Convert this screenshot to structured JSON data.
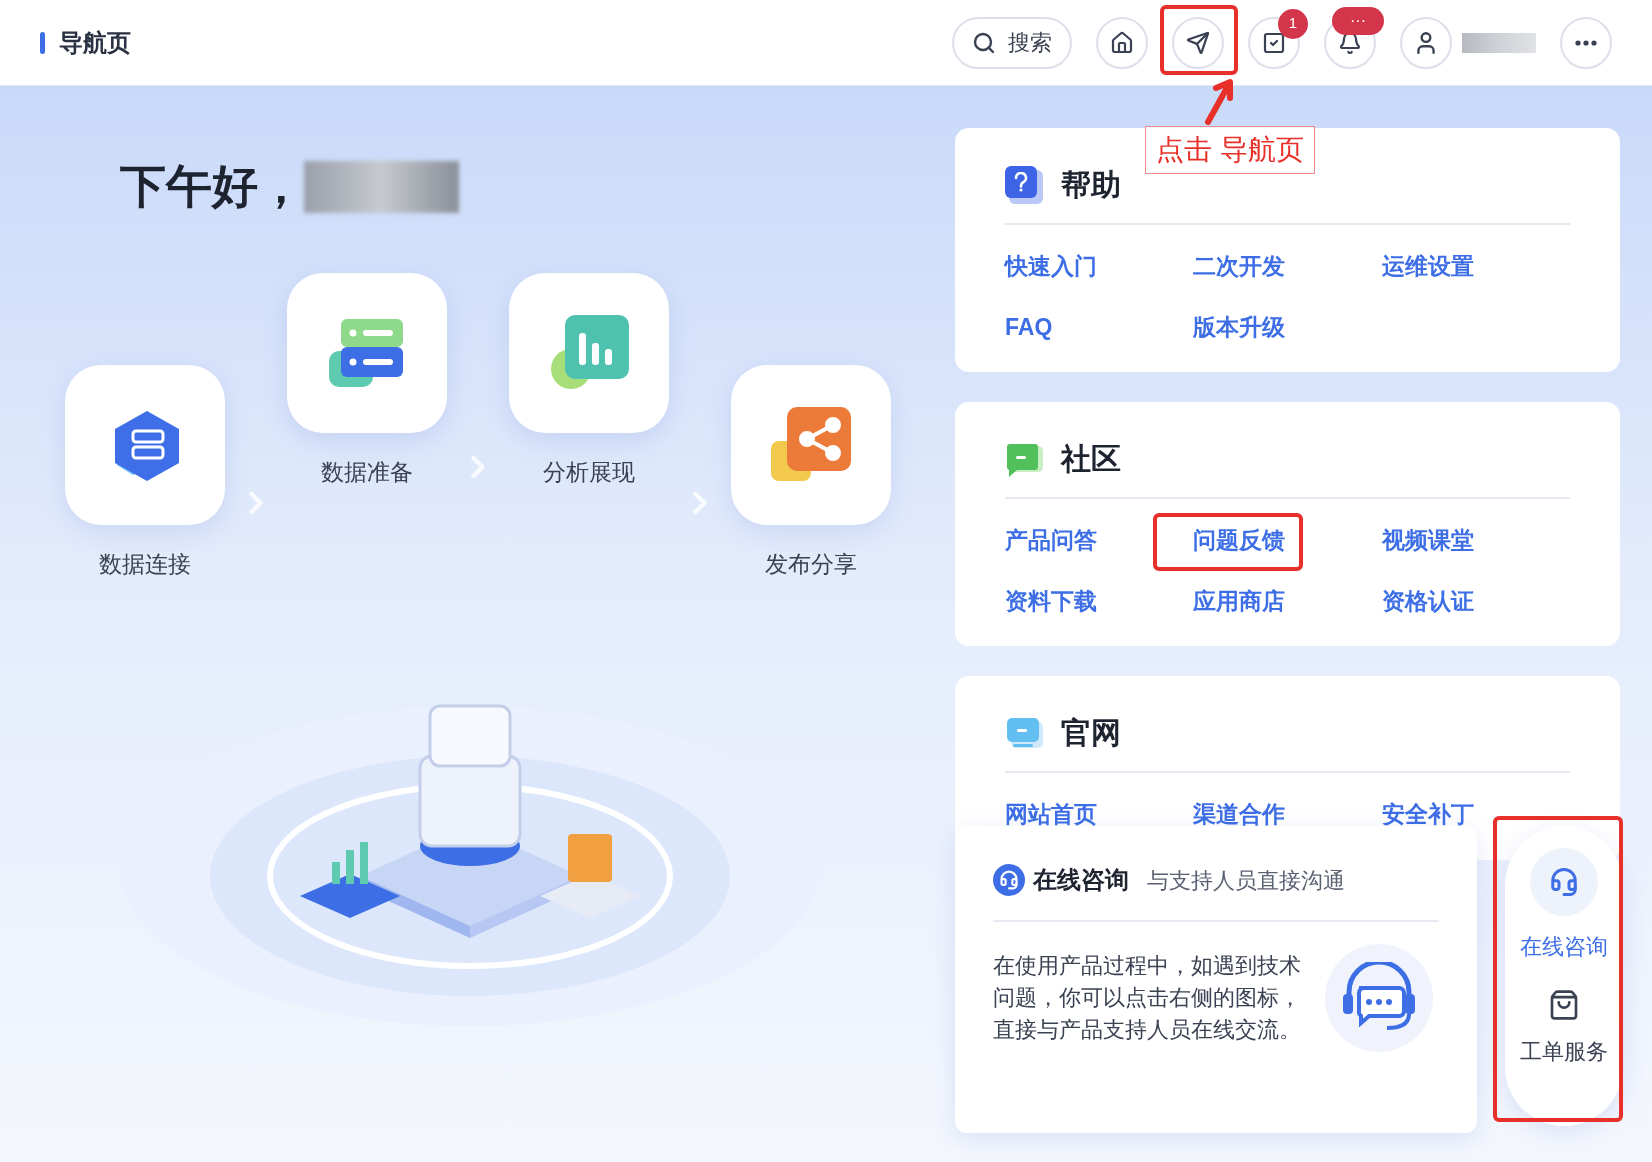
{
  "header": {
    "title": "导航页",
    "search_label": "搜索",
    "task_badge": "1",
    "notice_badge": "···",
    "nav_marked": true
  },
  "annotation": {
    "label": "点击 导航页"
  },
  "greeting": "下午好，",
  "steps": [
    {
      "label": "数据连接",
      "kind": "connect"
    },
    {
      "label": "数据准备",
      "kind": "prepare"
    },
    {
      "label": "分析展现",
      "kind": "analyze"
    },
    {
      "label": "发布分享",
      "kind": "publish"
    }
  ],
  "sections": [
    {
      "title": "帮助",
      "kind": "help",
      "links": [
        {
          "label": "快速入门",
          "marked": false
        },
        {
          "label": "二次开发",
          "marked": false
        },
        {
          "label": "运维设置",
          "marked": false
        },
        {
          "label": "FAQ",
          "marked": false
        },
        {
          "label": "版本升级",
          "marked": false
        }
      ]
    },
    {
      "title": "社区",
      "kind": "community",
      "links": [
        {
          "label": "产品问答",
          "marked": false
        },
        {
          "label": "问题反馈",
          "marked": true
        },
        {
          "label": "视频课堂",
          "marked": false
        },
        {
          "label": "资料下载",
          "marked": false
        },
        {
          "label": "应用商店",
          "marked": false
        },
        {
          "label": "资格认证",
          "marked": false
        }
      ]
    },
    {
      "title": "官网",
      "kind": "website",
      "links": [
        {
          "label": "网站首页",
          "marked": false
        },
        {
          "label": "渠道合作",
          "marked": false
        },
        {
          "label": "安全补丁",
          "marked": false
        }
      ]
    }
  ],
  "consult": {
    "title": "在线咨询",
    "subtitle": "与支持人员直接沟通",
    "body": "在使用产品过程中，如遇到技术问题，你可以点击右侧的图标，直接与产品支持人员在线交流。"
  },
  "side_menu": {
    "marked": true,
    "items": [
      {
        "label": "在线咨询",
        "kind": "headset",
        "selected": true
      },
      {
        "label": "工单服务",
        "kind": "bag",
        "selected": false
      }
    ]
  }
}
